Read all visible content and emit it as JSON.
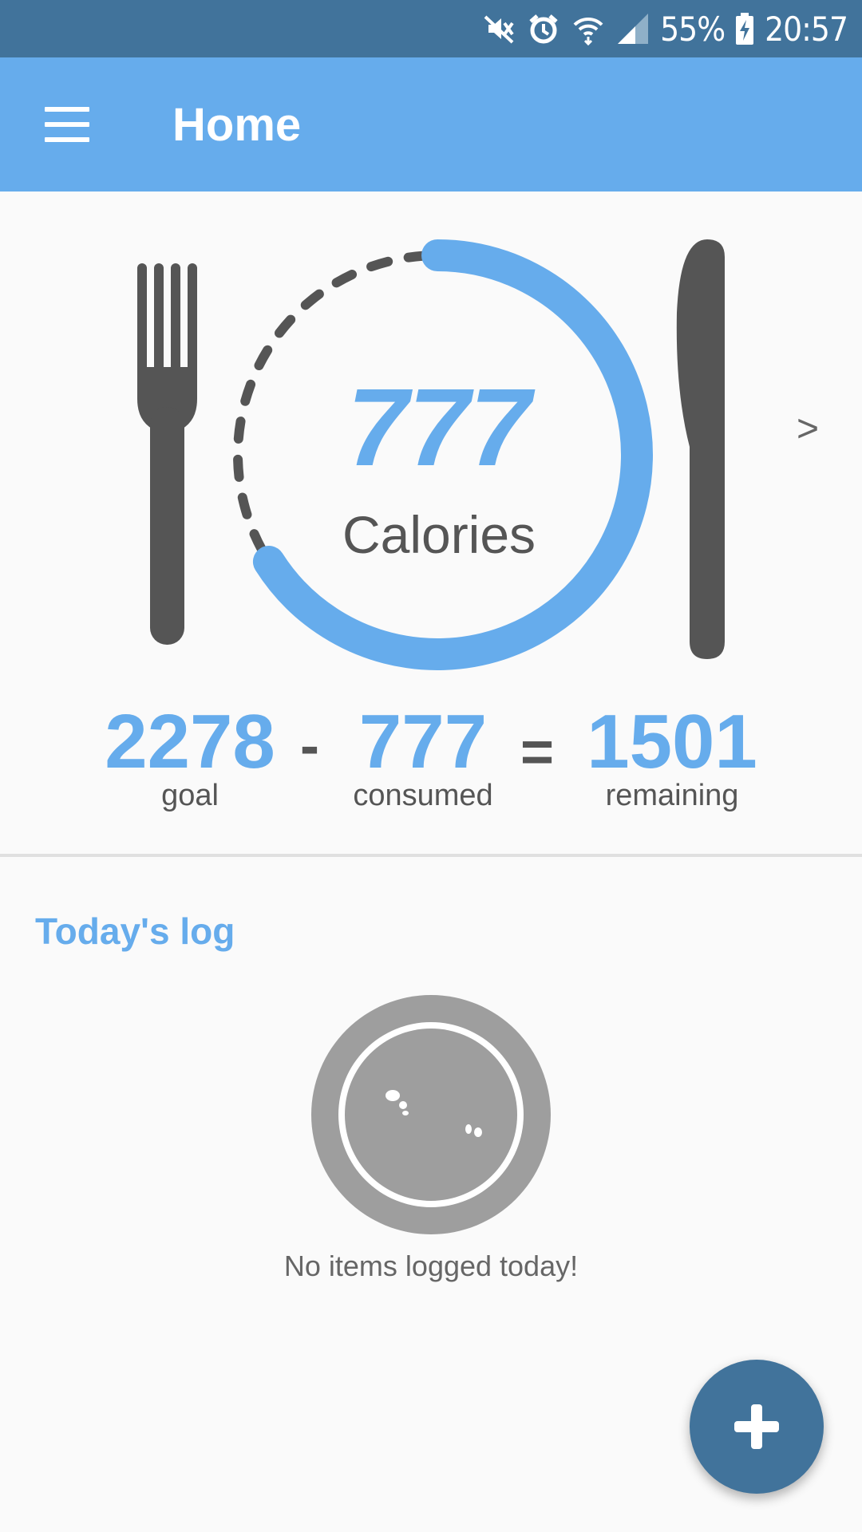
{
  "status_bar": {
    "battery": "55%",
    "time": "20:57",
    "icons": [
      "mute-icon",
      "alarm-icon",
      "wifi-icon",
      "signal-icon",
      "battery-charging-icon"
    ]
  },
  "app_bar": {
    "title": "Home",
    "menu_icon": "hamburger-menu-icon"
  },
  "hero": {
    "calories_value": "777",
    "calories_label": "Calories",
    "progress_fraction": 0.34,
    "next_label": ">"
  },
  "equation": {
    "goal_value": "2278",
    "goal_label": "goal",
    "minus": "-",
    "consumed_value": "777",
    "consumed_label": "consumed",
    "equals": "=",
    "remaining_value": "1501",
    "remaining_label": "remaining"
  },
  "log": {
    "title": "Today's log",
    "empty_message": "No items logged today!",
    "empty_icon": "empty-plate-icon"
  },
  "fab": {
    "icon": "plus-icon"
  },
  "colors": {
    "status_bar": "#41739b",
    "app_bar": "#66acec",
    "accent": "#66acec",
    "utensil": "#555555",
    "fab": "#41739b"
  }
}
